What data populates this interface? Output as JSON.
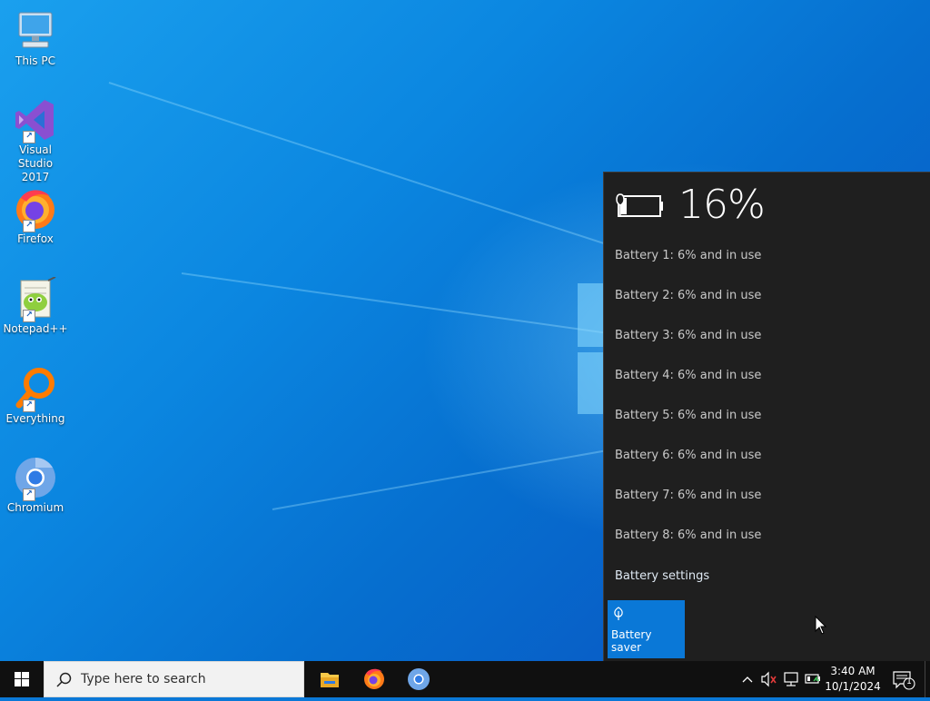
{
  "desktop": {
    "icons": [
      {
        "label_line1": "This PC",
        "label_line2": "",
        "icon": "computer-icon",
        "shortcut": false
      },
      {
        "label_line1": "Visual Studio",
        "label_line2": "2017",
        "icon": "visual-studio-icon",
        "shortcut": true
      },
      {
        "label_line1": "Firefox",
        "label_line2": "",
        "icon": "firefox-icon",
        "shortcut": true
      },
      {
        "label_line1": "Notepad++",
        "label_line2": "",
        "icon": "notepad-plus-plus-icon",
        "shortcut": true
      },
      {
        "label_line1": "Everything",
        "label_line2": "",
        "icon": "everything-search-icon",
        "shortcut": true
      },
      {
        "label_line1": "Chromium",
        "label_line2": "",
        "icon": "chromium-icon",
        "shortcut": true
      }
    ],
    "shortcut_glyph": "↗"
  },
  "battery_flyout": {
    "percentage": "16%",
    "charge_level": 0.16,
    "batteries": [
      "Battery 1: 6% and in use",
      "Battery 2: 6% and in use",
      "Battery 3: 6% and in use",
      "Battery 4: 6% and in use",
      "Battery 5: 6% and in use",
      "Battery 6: 6% and in use",
      "Battery 7: 6% and in use",
      "Battery 8: 6% and in use"
    ],
    "settings_link": "Battery settings",
    "saver_tile_label": "Battery saver",
    "accent": "#0a78d7"
  },
  "taskbar": {
    "search_placeholder": "Type here to search",
    "pinned_apps": [
      "file-explorer-icon",
      "firefox-icon",
      "chromium-icon"
    ],
    "tray_icons": [
      "chevron-up-icon",
      "volume-muted-icon",
      "network-icon",
      "battery-icon"
    ],
    "time": "3:40 AM",
    "date": "10/1/2024",
    "notification_count": "1"
  }
}
